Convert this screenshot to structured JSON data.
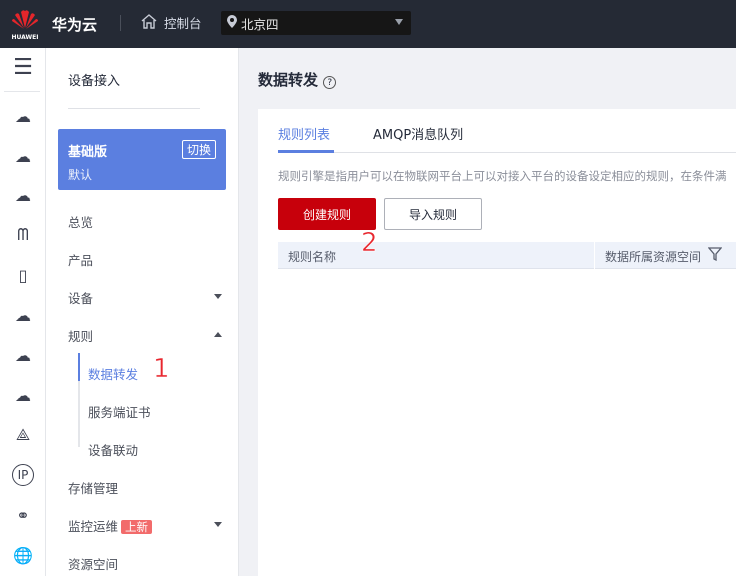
{
  "topbar": {
    "logo_text": "HUAWEI",
    "brand": "华为云",
    "console": "控制台",
    "region": "北京四"
  },
  "sidebar": {
    "title": "设备接入",
    "edition": {
      "name": "基础版",
      "switch": "切换",
      "instance": "默认"
    },
    "items": [
      {
        "label": "总览"
      },
      {
        "label": "产品"
      },
      {
        "label": "设备"
      },
      {
        "label": "规则"
      },
      {
        "label": "存储管理"
      },
      {
        "label": "监控运维",
        "badge": "上新"
      },
      {
        "label": "资源空间"
      }
    ],
    "rule_subitems": [
      {
        "label": "数据转发",
        "active": true
      },
      {
        "label": "服务端证书"
      },
      {
        "label": "设备联动"
      }
    ]
  },
  "main": {
    "title": "数据转发",
    "tabs": [
      {
        "label": "规则列表",
        "active": true
      },
      {
        "label": "AMQP消息队列"
      }
    ],
    "description": "规则引擎是指用户可以在物联网平台上可以对接入平台的设备设定相应的规则，在条件满",
    "create_button": "创建规则",
    "import_button": "导入规则",
    "table": {
      "columns": [
        "规则名称",
        "数据所属资源空间"
      ]
    }
  },
  "annotations": {
    "step1": "1",
    "step2": "2"
  },
  "colors": {
    "accent": "#5b7fe0",
    "primary_button": "#c7000b",
    "topbar": "#252a35"
  }
}
